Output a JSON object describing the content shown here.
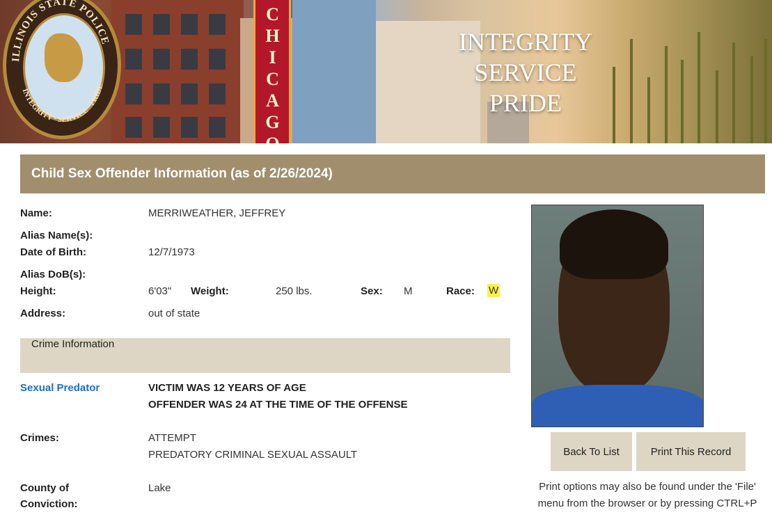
{
  "banner": {
    "seal_text_top": "ILLINOIS STATE POLICE",
    "seal_text_bottom": "INTEGRITY · SERVICE · PRIDE",
    "sign_text": "CHICAGO",
    "motto_line1": "INTEGRITY",
    "motto_line2": "SERVICE",
    "motto_line3": "PRIDE"
  },
  "header": {
    "title": "Child Sex Offender Information (as of 2/26/2024)"
  },
  "offender": {
    "name_label": "Name:",
    "name": "MERRIWEATHER, JEFFREY",
    "alias_label": "Alias Name(s):",
    "alias": "",
    "dob_label": "Date of Birth:",
    "dob": "12/7/1973",
    "alias_dob_label": "Alias DoB(s):",
    "alias_dob": "",
    "height_label": "Height:",
    "height": "6'03\"",
    "weight_label": "Weight:",
    "weight": "250 lbs.",
    "sex_label": "Sex:",
    "sex": "M",
    "race_label": "Race:",
    "race": "W",
    "address_label": "Address:",
    "address": "out of state"
  },
  "crime": {
    "section_title": "Crime Information",
    "status_link": "Sexual Predator",
    "victim_age": "VICTIM WAS 12 YEARS OF AGE",
    "offender_age": "OFFENDER WAS 24 AT THE TIME OF THE OFFENSE",
    "crimes_label": "Crimes:",
    "crime_line1": "ATTEMPT",
    "crime_line2": "PREDATORY CRIMINAL SEXUAL ASSAULT",
    "county_label_line1": "County of",
    "county_label_line2": "Conviction:",
    "county": "Lake"
  },
  "actions": {
    "back_label": "Back To List",
    "print_label": "Print This Record",
    "print_note_line1": "Print options may also be found under the 'File'",
    "print_note_line2": "menu from the browser or by pressing CTRL+P"
  },
  "colors": {
    "header_bg": "#a08e6d",
    "section_bg": "#ded6c5",
    "link": "#1a6fc9",
    "highlight": "#fbf04a"
  }
}
